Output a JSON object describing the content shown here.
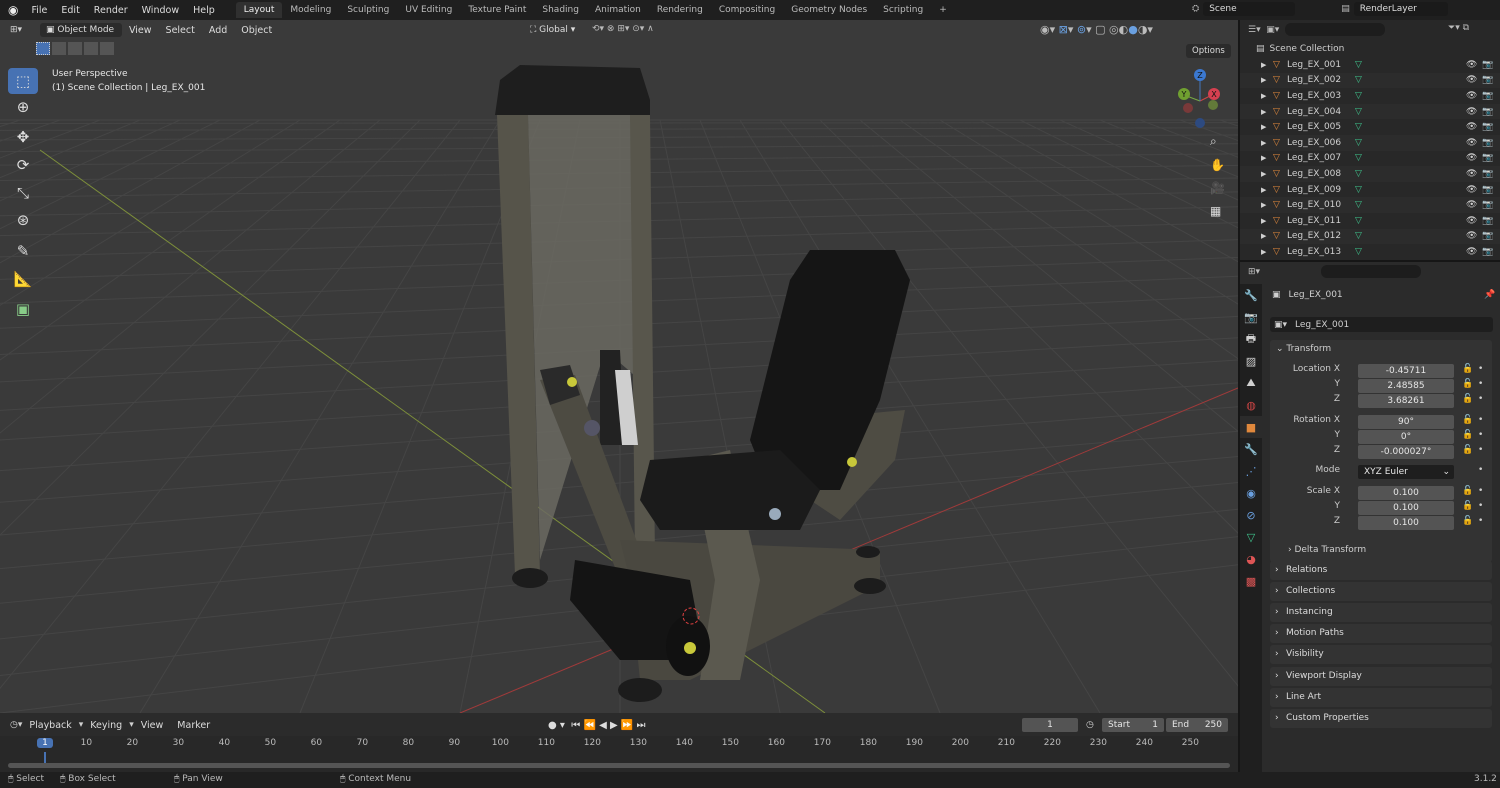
{
  "topbar": {
    "menus": [
      "File",
      "Edit",
      "Render",
      "Window",
      "Help"
    ],
    "workspaces": [
      "Layout",
      "Modeling",
      "Sculpting",
      "UV Editing",
      "Texture Paint",
      "Shading",
      "Animation",
      "Rendering",
      "Compositing",
      "Geometry Nodes",
      "Scripting"
    ],
    "active_workspace": "Layout",
    "add_tab": "+",
    "scene": "Scene",
    "view_layer": "RenderLayer"
  },
  "viewport": {
    "mode": "Object Mode",
    "menus": [
      "View",
      "Select",
      "Add",
      "Object"
    ],
    "orientation": "Global",
    "options": "Options",
    "overlay_title": "User Perspective",
    "overlay_subtitle": "(1) Scene Collection | Leg_EX_001",
    "gizmo": {
      "x": "X",
      "y": "Y",
      "z": "Z"
    }
  },
  "outliner": {
    "root": "Scene Collection",
    "items": [
      "Leg_EX_001",
      "Leg_EX_002",
      "Leg_EX_003",
      "Leg_EX_004",
      "Leg_EX_005",
      "Leg_EX_006",
      "Leg_EX_007",
      "Leg_EX_008",
      "Leg_EX_009",
      "Leg_EX_010",
      "Leg_EX_011",
      "Leg_EX_012",
      "Leg_EX_013"
    ]
  },
  "properties": {
    "object_name": "Leg_EX_001",
    "datablock": "Leg_EX_001",
    "transform": {
      "title": "Transform",
      "location_label": "Location X",
      "location": [
        "-0.45711",
        "2.48585",
        "3.68261"
      ],
      "rotation_label": "Rotation X",
      "rotation": [
        "90°",
        "0°",
        "-0.000027°"
      ],
      "mode_label": "Mode",
      "mode": "XYZ Euler",
      "scale_label": "Scale X",
      "scale": [
        "0.100",
        "0.100",
        "0.100"
      ],
      "y": "Y",
      "z": "Z"
    },
    "delta": "Delta Transform",
    "panels": [
      "Relations",
      "Collections",
      "Instancing",
      "Motion Paths",
      "Visibility",
      "Viewport Display",
      "Line Art",
      "Custom Properties"
    ]
  },
  "timeline": {
    "menus": [
      "Playback",
      "Keying",
      "View",
      "Marker"
    ],
    "current_frame": "1",
    "start_label": "Start",
    "start": "1",
    "end_label": "End",
    "end": "250",
    "ticks": [
      1,
      10,
      20,
      30,
      40,
      50,
      60,
      70,
      80,
      90,
      100,
      110,
      120,
      130,
      140,
      150,
      160,
      170,
      180,
      190,
      200,
      210,
      220,
      230,
      240,
      250
    ]
  },
  "status": {
    "items": [
      "Select",
      "Box Select",
      "Pan View",
      "Context Menu"
    ],
    "version": "3.1.2"
  },
  "colors": {
    "accent": "#4772b3",
    "object_orange": "#e0883c",
    "mesh_green": "#3fc48d"
  }
}
